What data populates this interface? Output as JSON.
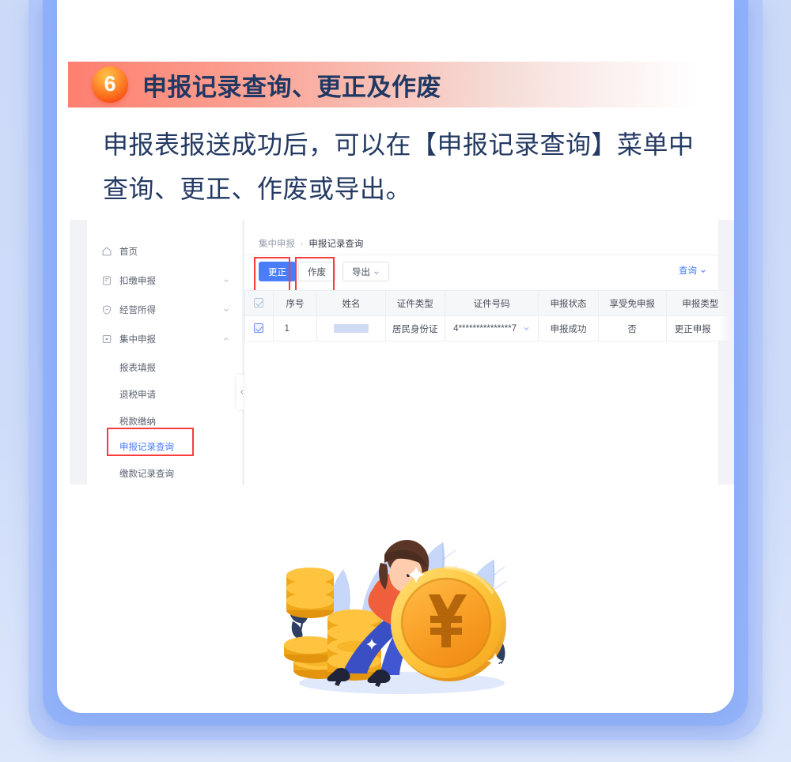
{
  "section": {
    "number": "6",
    "title": "申报记录查询、更正及作废",
    "paragraph": "申报表报送成功后，可以在【申报记录查询】菜单中查询、更正、作废或导出。"
  },
  "colors": {
    "banner_start": "#fd7f70",
    "badge": "#f32d08",
    "title_text": "#1f3864",
    "accent_blue": "#4a7dfc",
    "highlight_red": "#fa3c3c",
    "page_bg": "#ccdaf8"
  },
  "app": {
    "sidebar": {
      "items": [
        {
          "label": "首页",
          "icon": "home-icon",
          "expandable": false,
          "caret": ""
        },
        {
          "label": "扣缴申报",
          "icon": "file-icon",
          "expandable": true,
          "caret": "˅"
        },
        {
          "label": "经营所得",
          "icon": "shield-icon",
          "expandable": true,
          "caret": "˅"
        },
        {
          "label": "集中申报",
          "icon": "box-icon",
          "expandable": true,
          "caret": "˄"
        }
      ],
      "sub_items": [
        {
          "label": "报表填报",
          "active": false,
          "highlighted": false
        },
        {
          "label": "退税申请",
          "active": false,
          "highlighted": false
        },
        {
          "label": "税款缴纳",
          "active": false,
          "highlighted": false
        },
        {
          "label": "申报记录查询",
          "active": true,
          "highlighted": true
        },
        {
          "label": "缴款记录查询",
          "active": false,
          "highlighted": false
        }
      ]
    },
    "breadcrumb": {
      "parent": "集中申报",
      "separator": "›",
      "current": "申报记录查询"
    },
    "toolbar": {
      "correct_label": "更正",
      "void_label": "作废",
      "export_label": "导出",
      "export_caret": "˅",
      "query_label": "查询",
      "query_caret": "˅"
    },
    "table": {
      "headers": [
        "",
        "序号",
        "姓名",
        "证件类型",
        "证件号码",
        "申报状态",
        "享受免申报",
        "申报类型"
      ],
      "rows": [
        {
          "index": "1",
          "name": "",
          "id_type": "居民身份证",
          "id_number": "4***************7",
          "status": "申报成功",
          "exempt": "否",
          "declare_type": "更正申报"
        }
      ]
    }
  },
  "illustration": {
    "name": "woman-pushing-yuan-coin",
    "coin_symbol": "¥"
  }
}
